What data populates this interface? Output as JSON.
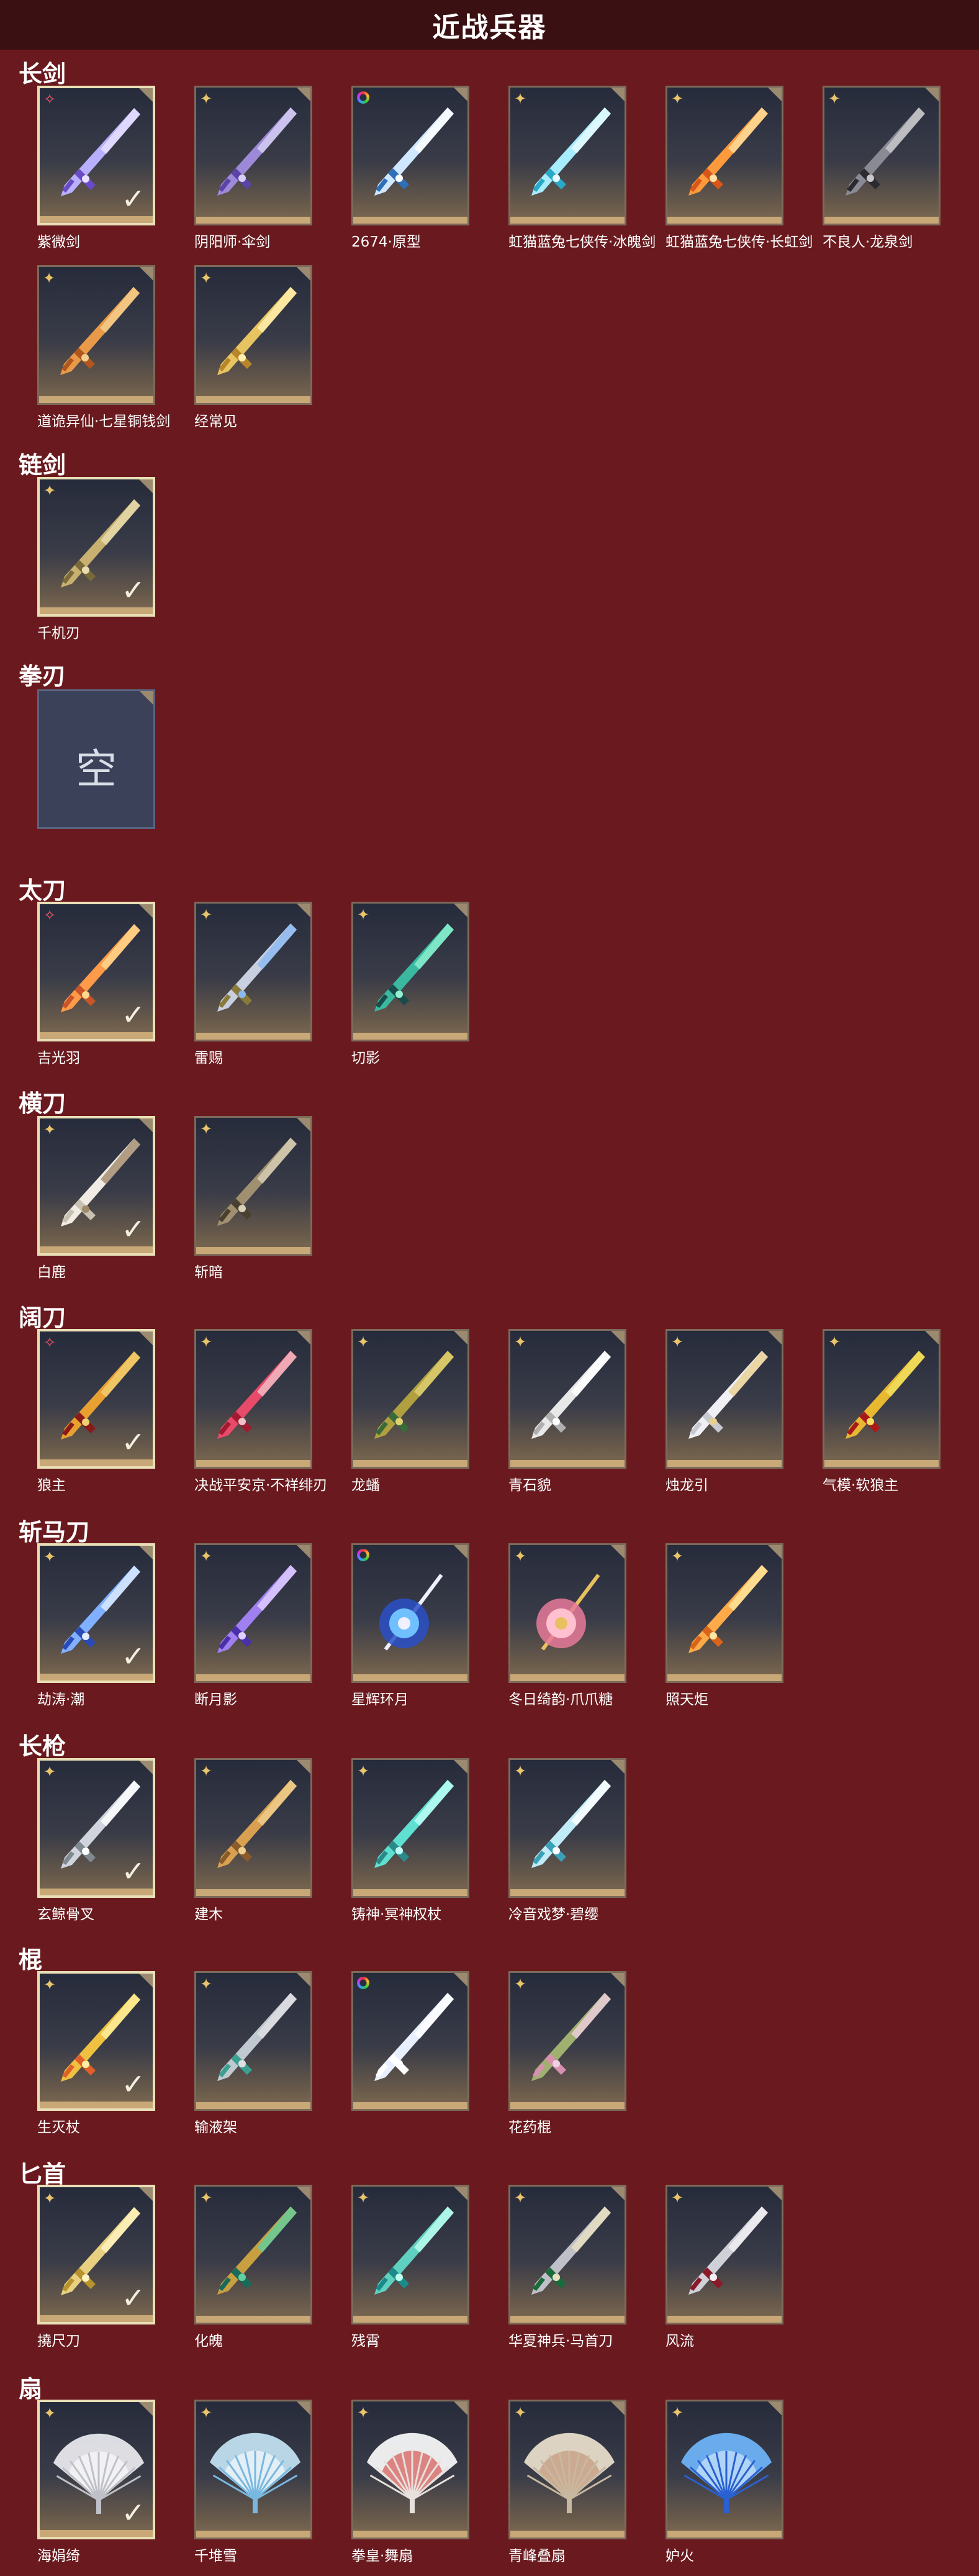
{
  "page": {
    "title": "近战兵器"
  },
  "empty_label": "空",
  "colors": {
    "background": "#6a1a1e",
    "header": "#3a1012",
    "card_bottom": "#c9a877",
    "selected_border": "#e9dfb6"
  },
  "sections": [
    {
      "title": "长剑",
      "items": [
        {
          "name": "紫微剑",
          "rarity": "red",
          "selected": true,
          "art": "sword-violet-icon"
        },
        {
          "name": "阴阳师·伞剑",
          "rarity": "gold",
          "selected": false,
          "art": "umbrella-sword-icon"
        },
        {
          "name": "2674·原型",
          "rarity": "rainbow",
          "selected": false,
          "art": "lightsaber-icon"
        },
        {
          "name": "虹猫蓝兔七侠传·冰魄剑",
          "rarity": "gold",
          "selected": false,
          "art": "ice-sword-icon"
        },
        {
          "name": "虹猫蓝兔七侠传·长虹剑",
          "rarity": "gold",
          "selected": false,
          "art": "fire-sword-icon"
        },
        {
          "name": "不良人·龙泉剑",
          "rarity": "gold",
          "selected": false,
          "art": "dark-sword-icon"
        },
        {
          "name": "道诡异仙·七星铜钱剑",
          "rarity": "gold",
          "selected": false,
          "art": "coin-sword-icon"
        },
        {
          "name": "经常见",
          "rarity": "gold",
          "selected": false,
          "art": "golden-sword-icon"
        }
      ]
    },
    {
      "title": "链剑",
      "items": [
        {
          "name": "千机刃",
          "rarity": "gold",
          "selected": true,
          "art": "chain-sword-icon"
        }
      ]
    },
    {
      "title": "拳刃",
      "items": [],
      "empty": true
    },
    {
      "title": "太刀",
      "items": [
        {
          "name": "吉光羽",
          "rarity": "red",
          "selected": true,
          "art": "flame-katana-icon"
        },
        {
          "name": "雷赐",
          "rarity": "gold",
          "selected": false,
          "art": "thunder-katana-icon"
        },
        {
          "name": "切影",
          "rarity": "gold",
          "selected": false,
          "art": "shadow-katana-icon"
        }
      ]
    },
    {
      "title": "横刀",
      "items": [
        {
          "name": "白鹿",
          "rarity": "gold",
          "selected": true,
          "art": "white-blade-icon"
        },
        {
          "name": "斩暗",
          "rarity": "gold",
          "selected": false,
          "art": "dark-blade-icon"
        }
      ]
    },
    {
      "title": "阔刀",
      "items": [
        {
          "name": "狼主",
          "rarity": "red",
          "selected": true,
          "art": "wolf-broadsword-icon"
        },
        {
          "name": "决战平安京·不祥绯刃",
          "rarity": "gold",
          "selected": false,
          "art": "red-blade-icon"
        },
        {
          "name": "龙蟠",
          "rarity": "gold",
          "selected": false,
          "art": "dragon-broadsword-icon"
        },
        {
          "name": "青石貌",
          "rarity": "gold",
          "selected": false,
          "art": "stone-broadsword-icon"
        },
        {
          "name": "烛龙引",
          "rarity": "gold",
          "selected": false,
          "art": "candle-dragon-icon"
        },
        {
          "name": "气模·软狼主",
          "rarity": "gold",
          "selected": false,
          "art": "inflatable-sword-icon"
        }
      ]
    },
    {
      "title": "斩马刀",
      "items": [
        {
          "name": "劫涛·潮",
          "rarity": "gold",
          "selected": true,
          "art": "wave-glaive-icon"
        },
        {
          "name": "断月影",
          "rarity": "gold",
          "selected": false,
          "art": "moon-glaive-icon"
        },
        {
          "name": "星辉环月",
          "rarity": "rainbow",
          "selected": false,
          "art": "star-ring-icon"
        },
        {
          "name": "冬日绮韵·爪爪糖",
          "rarity": "gold",
          "selected": false,
          "art": "candy-paw-icon"
        },
        {
          "name": "照天炬",
          "rarity": "gold",
          "selected": false,
          "art": "torch-glaive-icon"
        }
      ]
    },
    {
      "title": "长枪",
      "items": [
        {
          "name": "玄鲸骨叉",
          "rarity": "gold",
          "selected": true,
          "art": "whale-trident-icon"
        },
        {
          "name": "建木",
          "rarity": "gold",
          "selected": false,
          "art": "wood-spear-icon"
        },
        {
          "name": "铸神·冥神权杖",
          "rarity": "gold",
          "selected": false,
          "art": "scepter-spear-icon"
        },
        {
          "name": "冷音戏梦·碧缨",
          "rarity": "gold",
          "selected": false,
          "art": "jade-spear-icon"
        }
      ]
    },
    {
      "title": "棍",
      "items": [
        {
          "name": "生灭杖",
          "rarity": "gold",
          "selected": true,
          "art": "fire-staff-icon"
        },
        {
          "name": "输液架",
          "rarity": "gold",
          "selected": false,
          "art": "iv-stand-icon"
        },
        {
          "name": "",
          "rarity": "rainbow",
          "selected": false,
          "art": "light-staff-icon"
        },
        {
          "name": "花药棍",
          "rarity": "gold",
          "selected": false,
          "art": "flower-staff-icon"
        }
      ]
    },
    {
      "title": "匕首",
      "items": [
        {
          "name": "撓尺刀",
          "rarity": "gold",
          "selected": true,
          "art": "gold-dagger-icon"
        },
        {
          "name": "化魄",
          "rarity": "gold",
          "selected": false,
          "art": "curved-dagger-icon"
        },
        {
          "name": "残霄",
          "rarity": "gold",
          "selected": false,
          "art": "teal-dagger-icon"
        },
        {
          "name": "华夏神兵·马首刀",
          "rarity": "gold",
          "selected": false,
          "art": "horse-dagger-icon"
        },
        {
          "name": "风流",
          "rarity": "gold",
          "selected": false,
          "art": "silver-dagger-icon"
        }
      ]
    },
    {
      "title": "扇",
      "items": [
        {
          "name": "海娟绮",
          "rarity": "gold",
          "selected": true,
          "art": "lace-fan-icon"
        },
        {
          "name": "千堆雪",
          "rarity": "gold",
          "selected": false,
          "art": "snow-fan-icon"
        },
        {
          "name": "拳皇·舞扇",
          "rarity": "gold",
          "selected": false,
          "art": "kof-fan-icon"
        },
        {
          "name": "青峰叠扇",
          "rarity": "gold",
          "selected": false,
          "art": "folded-fan-icon"
        },
        {
          "name": "妒火",
          "rarity": "gold",
          "selected": false,
          "art": "blue-feather-fan-icon"
        }
      ]
    }
  ]
}
